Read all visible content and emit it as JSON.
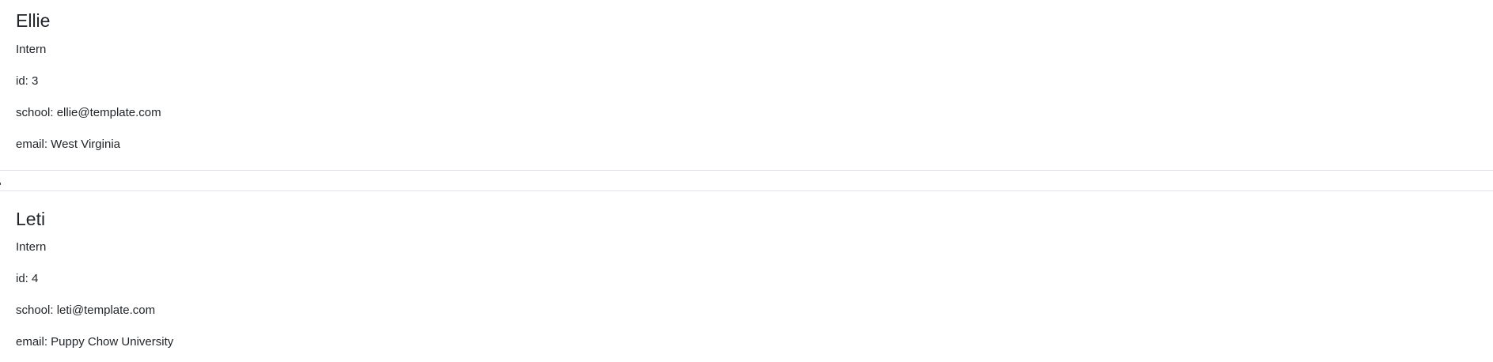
{
  "employees": [
    {
      "name": "Ellie",
      "role": "Intern",
      "id_text": "id: 3",
      "school_text": "school: ellie@template.com",
      "email_text": "email: West Virginia"
    },
    {
      "name": "Leti",
      "role": "Intern",
      "id_text": "id: 4",
      "school_text": "school: leti@template.com",
      "email_text": "email: Puppy Chow University"
    }
  ],
  "colors": {
    "text": "#212529",
    "border": "#dfe2e6",
    "background": "#ffffff"
  }
}
